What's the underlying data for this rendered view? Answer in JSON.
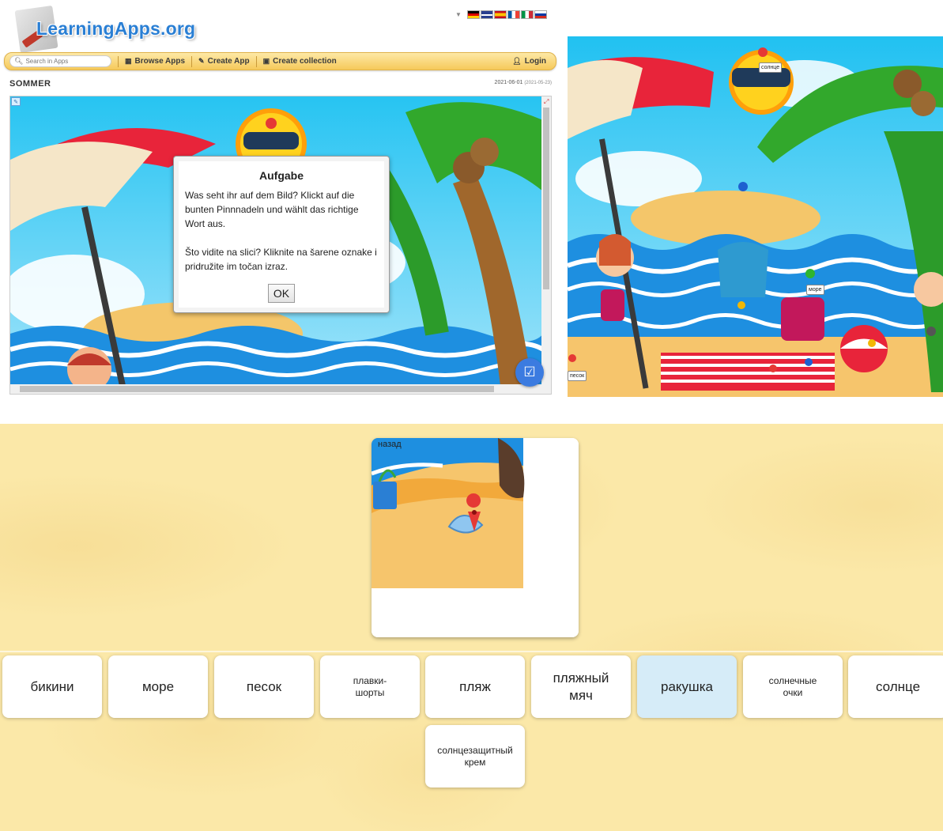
{
  "header": {
    "logo_text": "LearningApps.org",
    "languages": [
      "de",
      "en",
      "es",
      "fr",
      "it",
      "ru"
    ]
  },
  "navbar": {
    "search_placeholder": "Search in Apps",
    "browse": "Browse Apps",
    "create_app": "Create App",
    "create_collection": "Create collection",
    "login": "Login"
  },
  "app": {
    "title": "SOMMER",
    "date": "2021-06-01",
    "date_small": "(2021-05-23)"
  },
  "dialog": {
    "title": "Aufgabe",
    "text": "Was seht ihr auf dem Bild? Klickt auf die bunten Pinnnadeln und wählt das richtige Wort aus.\n\nŠto vidite na slici? Kliknite na šarene oznake i pridružite im točan izraz.",
    "ok": "OK"
  },
  "scene_labels": {
    "sun": "солнце",
    "sea": "море",
    "sand": "песок"
  },
  "quiz": {
    "back": "назад",
    "options": [
      {
        "label": "бикини",
        "selected": false
      },
      {
        "label": "море",
        "selected": false
      },
      {
        "label": "песок",
        "selected": false
      },
      {
        "label": "плавки-\nшорты",
        "selected": false
      },
      {
        "label": "пляж",
        "selected": false
      },
      {
        "label": "пляжный\nмяч",
        "selected": false
      },
      {
        "label": "ракушка",
        "selected": true
      },
      {
        "label": "солнечные\nочки",
        "selected": false
      },
      {
        "label": "солнце",
        "selected": false
      },
      {
        "label": "солнцезащитный\nкрем",
        "selected": false
      }
    ]
  },
  "colors": {
    "accent_blue": "#3b7be0",
    "navbar": "#f6c95a",
    "quiz_bg": "#fbe8a8",
    "selected_option": "#d6ecf8"
  }
}
